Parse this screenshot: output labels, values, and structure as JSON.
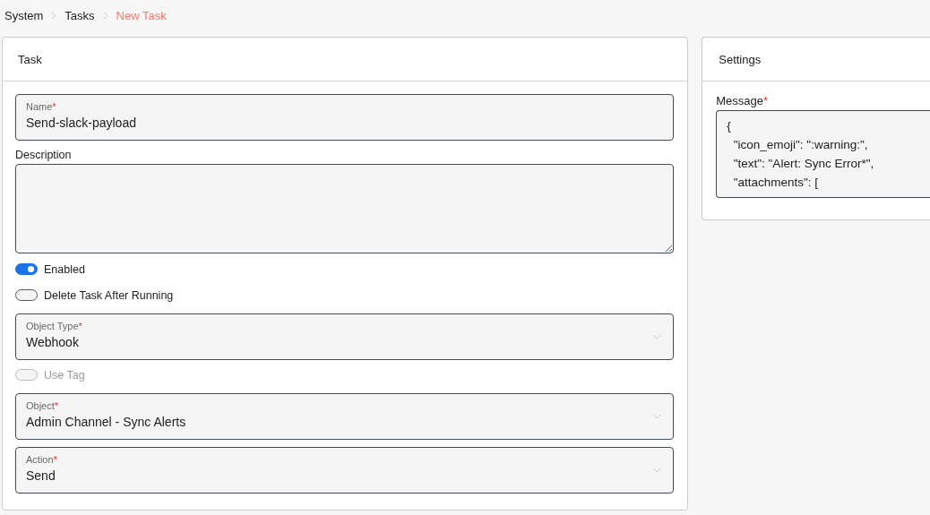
{
  "breadcrumb": [
    {
      "label": "System",
      "current": false
    },
    {
      "label": "Tasks",
      "current": false
    },
    {
      "label": "New Task",
      "current": true
    }
  ],
  "task_card": {
    "title": "Task",
    "fields": [
      {
        "kind": "text",
        "label": "Name",
        "required_mark": "*",
        "value": "Send-slack-payload"
      },
      {
        "kind": "textarea",
        "label": "Description"
      },
      {
        "kind": "toggle",
        "label": "Enabled",
        "on": true,
        "disabled": false
      },
      {
        "kind": "toggle",
        "label": "Delete Task After Running",
        "on": false,
        "disabled": false
      },
      {
        "kind": "select",
        "label": "Object Type",
        "required_mark": "*",
        "value": "Webhook"
      },
      {
        "kind": "toggle",
        "label": "Use Tag",
        "on": false,
        "disabled": true
      },
      {
        "kind": "select",
        "label": "Object",
        "required_mark": "*",
        "value": "Admin Channel - Sync Alerts"
      },
      {
        "kind": "select",
        "label": "Action",
        "required_mark": "*",
        "value": "Send"
      }
    ]
  },
  "settings_card": {
    "title": "Settings",
    "message": {
      "label": "Message",
      "required_mark": "*",
      "lines": [
        "{",
        "  \"icon_emoji\": \":warning:\",",
        "  \"text\": \"Alert: Sync Error*\",",
        "  \"attachments\": ["
      ]
    }
  }
}
